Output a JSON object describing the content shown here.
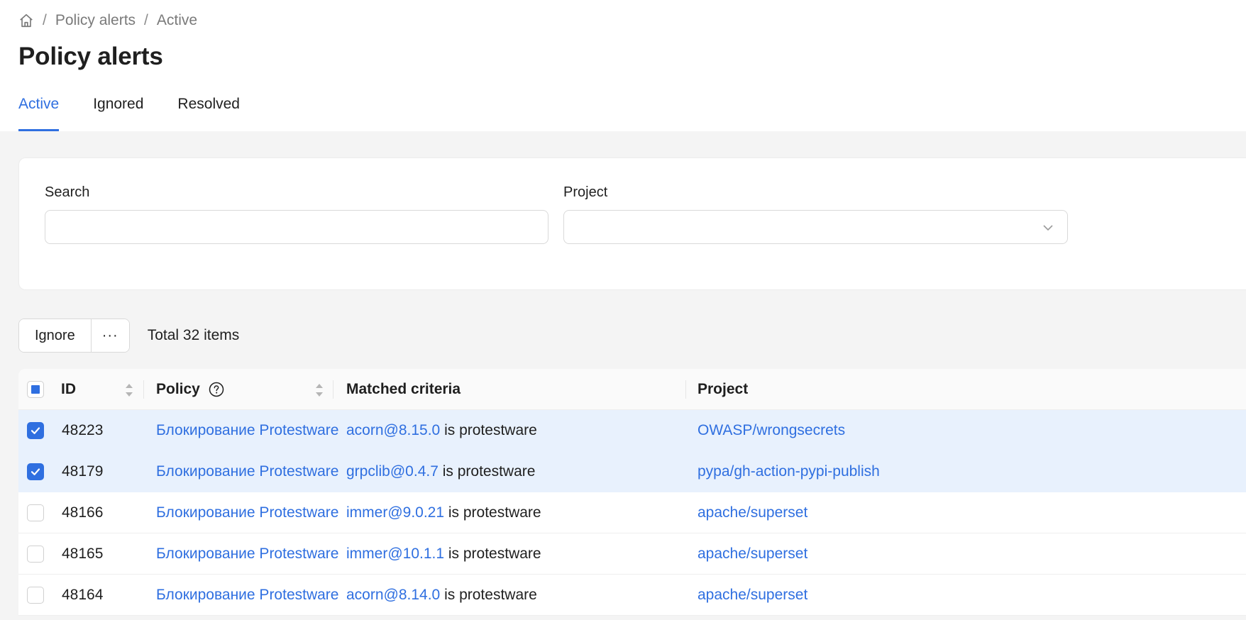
{
  "breadcrumb": {
    "home_icon": "home-icon",
    "items": [
      "Policy alerts",
      "Active"
    ],
    "separator": "/"
  },
  "page": {
    "title": "Policy alerts"
  },
  "tabs": [
    {
      "label": "Active",
      "active": true
    },
    {
      "label": "Ignored",
      "active": false
    },
    {
      "label": "Resolved",
      "active": false
    }
  ],
  "filters": {
    "search_label": "Search",
    "search_value": "",
    "project_label": "Project",
    "project_value": ""
  },
  "toolbar": {
    "ignore_label": "Ignore",
    "more_label": "···",
    "total_text": "Total 32 items"
  },
  "table": {
    "headers": {
      "id": "ID",
      "policy": "Policy",
      "matched": "Matched criteria",
      "project": "Project"
    },
    "rows": [
      {
        "selected": true,
        "id": "48223",
        "policy": "Блокирование Protestware",
        "package": "acorn@8.15.0",
        "criteria_suffix": "is protestware",
        "project": "OWASP/wrongsecrets"
      },
      {
        "selected": true,
        "id": "48179",
        "policy": "Блокирование Protestware",
        "package": "grpclib@0.4.7",
        "criteria_suffix": "is protestware",
        "project": "pypa/gh-action-pypi-publish"
      },
      {
        "selected": false,
        "id": "48166",
        "policy": "Блокирование Protestware",
        "package": "immer@9.0.21",
        "criteria_suffix": "is protestware",
        "project": "apache/superset"
      },
      {
        "selected": false,
        "id": "48165",
        "policy": "Блокирование Protestware",
        "package": "immer@10.1.1",
        "criteria_suffix": "is protestware",
        "project": "apache/superset"
      },
      {
        "selected": false,
        "id": "48164",
        "policy": "Блокирование Protestware",
        "package": "acorn@8.14.0",
        "criteria_suffix": "is protestware",
        "project": "apache/superset"
      }
    ]
  },
  "colors": {
    "accent": "#2f6fe0",
    "selected_row": "#e8f1fd",
    "content_bg": "#f4f4f4"
  }
}
